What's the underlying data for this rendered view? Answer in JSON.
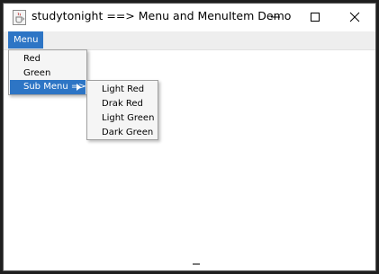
{
  "window": {
    "title": "studytonight ==> Menu and MenuItem Demo",
    "icon": "java-cup-icon",
    "controls": [
      "minimize-icon",
      "maximize-icon",
      "close-icon"
    ]
  },
  "menubar": {
    "menu_label": "Menu"
  },
  "menu_popup": {
    "items": [
      "Red",
      "Green",
      "Sub Menu =>"
    ],
    "highlighted": "Sub Menu =>"
  },
  "submenu_popup": {
    "items": [
      "Light Red",
      "Drak Red",
      "Light Green",
      "Dark Green"
    ]
  },
  "colors": {
    "highlight": "#2d75c5",
    "popup_bg": "#f5f5f5",
    "menubar_bg": "#eeeeee"
  }
}
